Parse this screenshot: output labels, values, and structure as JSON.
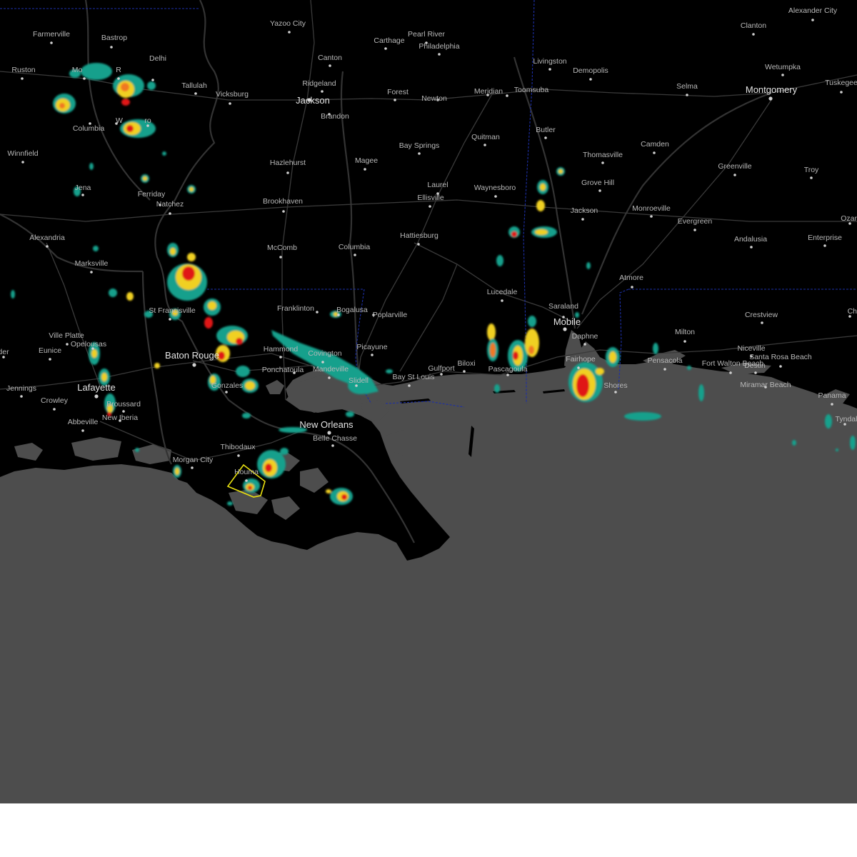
{
  "colors": {
    "land": "#000000",
    "water": "#4d4d4d",
    "roads": "#3a3a3a",
    "state_border": "#1c2fa8",
    "rivers": "#323232",
    "warning_polygon": "#e8e010",
    "radar": {
      "light": "#12a08c",
      "moderate": "#f0d020",
      "heavy": "#f07820",
      "intense": "#e01818"
    }
  },
  "cities": [
    {
      "name": "Farmerville",
      "major": false
    },
    {
      "name": "Bastrop",
      "major": false
    },
    {
      "name": "Yazoo City",
      "major": false
    },
    {
      "name": "Carthage",
      "major": false
    },
    {
      "name": "Pearl River",
      "major": false
    },
    {
      "name": "Philadelphia",
      "major": false
    },
    {
      "name": "Clanton",
      "major": false
    },
    {
      "name": "Alexander City",
      "major": false
    },
    {
      "name": "Ruston",
      "major": false
    },
    {
      "name": "Mo",
      "major": false
    },
    {
      "name": "R",
      "major": false
    },
    {
      "name": "Delhi",
      "major": false
    },
    {
      "name": "Tallulah",
      "major": false
    },
    {
      "name": "Vicksburg",
      "major": false
    },
    {
      "name": "Canton",
      "major": false
    },
    {
      "name": "Ridgeland",
      "major": false
    },
    {
      "name": "Jackson",
      "major": true
    },
    {
      "name": "Brandon",
      "major": false
    },
    {
      "name": "Forest",
      "major": false
    },
    {
      "name": "Newton",
      "major": false
    },
    {
      "name": "Meridian",
      "major": false
    },
    {
      "name": "Toomsuba",
      "major": false
    },
    {
      "name": "Livingston",
      "major": false
    },
    {
      "name": "Demopolis",
      "major": false
    },
    {
      "name": "Selma",
      "major": false
    },
    {
      "name": "Montgomery",
      "major": true
    },
    {
      "name": "Wetumpka",
      "major": false
    },
    {
      "name": "Tuskegee",
      "major": false
    },
    {
      "name": "Columbia",
      "major": false
    },
    {
      "name": "W",
      "major": false
    },
    {
      "name": "ro",
      "major": false
    },
    {
      "name": "Winnfield",
      "major": false
    },
    {
      "name": "Hazlehurst",
      "major": false
    },
    {
      "name": "Magee",
      "major": false
    },
    {
      "name": "Bay Springs",
      "major": false
    },
    {
      "name": "Quitman",
      "major": false
    },
    {
      "name": "Butler",
      "major": false
    },
    {
      "name": "Thomasville",
      "major": false
    },
    {
      "name": "Camden",
      "major": false
    },
    {
      "name": "Greenville",
      "major": false
    },
    {
      "name": "Troy",
      "major": false
    },
    {
      "name": "Jena",
      "major": false
    },
    {
      "name": "Ferriday",
      "major": false
    },
    {
      "name": "Natchez",
      "major": false
    },
    {
      "name": "Brookhaven",
      "major": false
    },
    {
      "name": "Laurel",
      "major": false
    },
    {
      "name": "Ellisville",
      "major": false
    },
    {
      "name": "Waynesboro",
      "major": false
    },
    {
      "name": "Grove Hill",
      "major": false
    },
    {
      "name": "Jackson",
      "major": false
    },
    {
      "name": "Monroeville",
      "major": false
    },
    {
      "name": "Evergreen",
      "major": false
    },
    {
      "name": "Ozar",
      "major": false
    },
    {
      "name": "Alexandria",
      "major": false
    },
    {
      "name": "McComb",
      "major": false
    },
    {
      "name": "Columbia",
      "major": false
    },
    {
      "name": "Hattiesburg",
      "major": false
    },
    {
      "name": "Andalusia",
      "major": false
    },
    {
      "name": "Enterprise",
      "major": false
    },
    {
      "name": "Marksville",
      "major": false
    },
    {
      "name": "Atmore",
      "major": false
    },
    {
      "name": "Lucedale",
      "major": false
    },
    {
      "name": "St Francisville",
      "major": false
    },
    {
      "name": "Franklinton",
      "major": false
    },
    {
      "name": "Bogalusa",
      "major": false
    },
    {
      "name": "Poplarville",
      "major": false
    },
    {
      "name": "Saraland",
      "major": false
    },
    {
      "name": "Mobile",
      "major": true
    },
    {
      "name": "Crestview",
      "major": false
    },
    {
      "name": "Ch",
      "major": false
    },
    {
      "name": "Ville Platte",
      "major": false
    },
    {
      "name": "Milton",
      "major": false
    },
    {
      "name": "Daphne",
      "major": false
    },
    {
      "name": "Eunice",
      "major": false
    },
    {
      "name": "Opelousas",
      "major": false
    },
    {
      "name": "Baton Rouge",
      "major": true
    },
    {
      "name": "Hammond",
      "major": false
    },
    {
      "name": "Covington",
      "major": false
    },
    {
      "name": "Picayune",
      "major": false
    },
    {
      "name": "Niceville",
      "major": false
    },
    {
      "name": "Santa Rosa Beach",
      "major": false
    },
    {
      "name": "der",
      "major": false
    },
    {
      "name": "Fairhope",
      "major": false
    },
    {
      "name": "Pensacola",
      "major": false
    },
    {
      "name": "Fort Walton Beach",
      "major": false
    },
    {
      "name": "Destin",
      "major": false
    },
    {
      "name": "Biloxi",
      "major": false
    },
    {
      "name": "Gulfport",
      "major": false
    },
    {
      "name": "Ponchatoula",
      "major": false
    },
    {
      "name": "Mandeville",
      "major": false
    },
    {
      "name": "Pascagoula",
      "major": false
    },
    {
      "name": "Bay St Louis",
      "major": false
    },
    {
      "name": "Slidell",
      "major": false
    },
    {
      "name": "Jennings",
      "major": false
    },
    {
      "name": "Lafayette",
      "major": true
    },
    {
      "name": "Gonzales",
      "major": false
    },
    {
      "name": "Shores",
      "major": false
    },
    {
      "name": "Miramar Beach",
      "major": false
    },
    {
      "name": "Crowley",
      "major": false
    },
    {
      "name": "Broussard",
      "major": false
    },
    {
      "name": "Panama",
      "major": false
    },
    {
      "name": "Tyndal",
      "major": false
    },
    {
      "name": "Abbeville",
      "major": false
    },
    {
      "name": "New Iberia",
      "major": false
    },
    {
      "name": "New Orleans",
      "major": true
    },
    {
      "name": "Belle Chasse",
      "major": false
    },
    {
      "name": "Thibodaux",
      "major": false
    },
    {
      "name": "Morgan City",
      "major": false
    },
    {
      "name": "Houma",
      "major": false
    }
  ]
}
